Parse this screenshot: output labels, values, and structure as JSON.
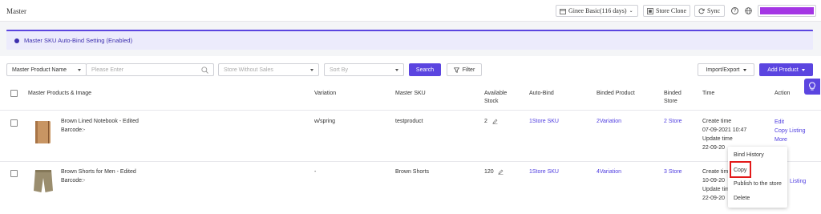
{
  "header": {
    "title": "Master",
    "plan_label": "Ginee Basic(116 days)",
    "store_clone_label": "Store Clone",
    "sync_label": "Sync"
  },
  "banner": {
    "text": "Master SKU Auto-Bind Setting (Enabled)"
  },
  "filters": {
    "search_field": "Master Product Name",
    "search_placeholder": "Please Enter",
    "store_filter": "Store Without Sales",
    "sort_by": "Sort By",
    "search_label": "Search",
    "filter_label": "Filter",
    "import_export_label": "Import/Export",
    "add_product_label": "Add Product"
  },
  "table": {
    "columns": {
      "product": "Master Products & Image",
      "variation": "Variation",
      "sku": "Master SKU",
      "stock_line1": "Available",
      "stock_line2": "Stock",
      "auto_bind": "Auto-Bind",
      "binded_product": "Binded Product",
      "binded_store_line1": "Binded",
      "binded_store_line2": "Store",
      "time": "Time",
      "action": "Action"
    },
    "rows": [
      {
        "name": "Brown Lined Notebook - Edited",
        "barcode": "Barcode:-",
        "variation": "w/spring",
        "sku": "testproduct",
        "stock": "2",
        "auto_bind": "1Store SKU",
        "binded_product": "2Variation",
        "binded_store": "2 Store",
        "create_label": "Create time",
        "create_time": "07-09-2021 10:47",
        "update_label": "Update time",
        "update_time": "22-09-20",
        "action_edit": "Edit",
        "action_copy_listing": "Copy Listing",
        "action_more": "More"
      },
      {
        "name": "Brown Shorts for Men - Edited",
        "barcode": "Barcode:-",
        "variation": "-",
        "sku": "Brown Shorts",
        "stock": "120",
        "auto_bind": "1Store SKU",
        "binded_product": "4Variation",
        "binded_store": "3 Store",
        "create_label": "Create tim",
        "create_time": "10-09-20",
        "update_label": "Update tim",
        "update_time": "22-09-20",
        "action_listing": "Listing"
      }
    ]
  },
  "more_menu": {
    "items": [
      "Bind History",
      "Copy",
      "Publish to the store",
      "Delete"
    ]
  },
  "colors": {
    "primary": "#5b45e0",
    "highlight": "#e21a1a",
    "avatar_bar": "#a436e4"
  }
}
